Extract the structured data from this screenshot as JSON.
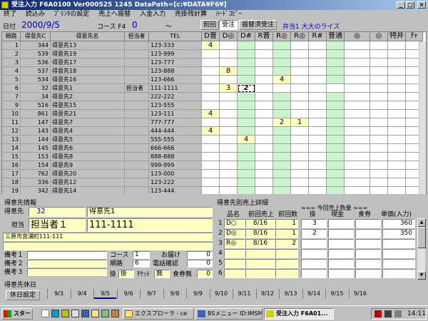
{
  "window": {
    "title": "受注入力 F6A0100 Ver000525 1245  DataPath=[c:¥DATA¥F6¥]"
  },
  "menu": [
    "終了",
    "読込み",
    "ﾌﾟﾘﾝﾀの設定",
    "売上へ振替",
    "入金入力",
    "売掛残計算",
    "ﾊｰﾄﾞｺﾋﾟｰ"
  ],
  "header": {
    "date_label": "日付",
    "date": "2000/9/5",
    "course_label": "コース F4",
    "course": "0",
    "tilde": "～",
    "tabs": [
      "前回",
      "受注",
      "振替済受注"
    ],
    "active_tab": 1,
    "right_info": "弁当1 大大のライス"
  },
  "grid": {
    "columns": [
      "順路",
      "得意先C",
      "得意先名",
      "担当者",
      "TEL",
      "D普",
      "D◎",
      "D#",
      "R普",
      "R◎",
      "R◎",
      "R#",
      "普通",
      "◎",
      "特弁",
      "ﾁｬ"
    ],
    "rows": [
      {
        "no": "1",
        "code": "344",
        "name": "得意先13",
        "tan": "",
        "tel": "123-333",
        "q": [
          [
            "4",
            "yellow"
          ],
          [
            "",
            ""
          ],
          [
            "",
            "green"
          ],
          [
            "",
            ""
          ],
          [
            "",
            "green"
          ],
          [
            "",
            ""
          ],
          [
            "",
            ""
          ],
          [
            "",
            "green"
          ],
          [
            "",
            ""
          ],
          [
            "",
            ""
          ],
          [
            "",
            ""
          ],
          [
            "",
            ""
          ],
          [
            "",
            ""
          ]
        ]
      },
      {
        "no": "2",
        "code": "539",
        "name": "得意先19",
        "tan": "",
        "tel": "123-999",
        "q": [
          [
            "",
            ""
          ],
          [
            "",
            ""
          ],
          [
            "",
            "green"
          ],
          [
            "",
            ""
          ],
          [
            "",
            "green"
          ],
          [
            "",
            ""
          ],
          [
            "",
            ""
          ],
          [
            "",
            "green"
          ],
          [
            "",
            ""
          ],
          [
            "",
            ""
          ],
          [
            "",
            ""
          ],
          [
            "",
            ""
          ],
          [
            "",
            ""
          ]
        ]
      },
      {
        "no": "3",
        "code": "536",
        "name": "得意先17",
        "tan": "",
        "tel": "123-777",
        "q": [
          [
            "",
            ""
          ],
          [
            "",
            ""
          ],
          [
            "",
            "green"
          ],
          [
            "",
            ""
          ],
          [
            "",
            "green"
          ],
          [
            "",
            ""
          ],
          [
            "",
            ""
          ],
          [
            "",
            "green"
          ],
          [
            "",
            ""
          ],
          [
            "",
            ""
          ],
          [
            "",
            ""
          ],
          [
            "",
            ""
          ],
          [
            "",
            ""
          ]
        ]
      },
      {
        "no": "4",
        "code": "537",
        "name": "得意先18",
        "tan": "",
        "tel": "123-888",
        "q": [
          [
            "",
            ""
          ],
          [
            "8",
            "yellow"
          ],
          [
            "",
            "green"
          ],
          [
            "",
            ""
          ],
          [
            "",
            "green"
          ],
          [
            "",
            ""
          ],
          [
            "",
            ""
          ],
          [
            "",
            "green"
          ],
          [
            "",
            ""
          ],
          [
            "",
            ""
          ],
          [
            "",
            ""
          ],
          [
            "",
            ""
          ],
          [
            "",
            ""
          ]
        ]
      },
      {
        "no": "5",
        "code": "534",
        "name": "得意先16",
        "tan": "",
        "tel": "123-666",
        "q": [
          [
            "",
            ""
          ],
          [
            "",
            ""
          ],
          [
            "",
            "green"
          ],
          [
            "",
            ""
          ],
          [
            "4",
            "yellow"
          ],
          [
            "",
            ""
          ],
          [
            "",
            ""
          ],
          [
            "",
            "green"
          ],
          [
            "",
            ""
          ],
          [
            "",
            ""
          ],
          [
            "",
            ""
          ],
          [
            "",
            ""
          ],
          [
            "",
            ""
          ]
        ]
      },
      {
        "no": "6",
        "code": "32",
        "name": "得意先1",
        "tan": "担当者",
        "tel": "111-1111",
        "q": [
          [
            "",
            ""
          ],
          [
            "3",
            "yellow"
          ],
          [
            "2",
            "sel"
          ],
          [
            "",
            ""
          ],
          [
            "",
            ""
          ],
          [
            "",
            ""
          ],
          [
            "",
            ""
          ],
          [
            "",
            ""
          ],
          [
            "",
            ""
          ],
          [
            "",
            ""
          ],
          [
            "",
            ""
          ],
          [
            "",
            ""
          ],
          [
            "",
            ""
          ]
        ]
      },
      {
        "no": "7",
        "code": "34",
        "name": "得意先2",
        "tan": "",
        "tel": "222-222",
        "q": [
          [
            "",
            ""
          ],
          [
            "",
            ""
          ],
          [
            "",
            "green"
          ],
          [
            "",
            ""
          ],
          [
            "",
            "green"
          ],
          [
            "",
            ""
          ],
          [
            "",
            ""
          ],
          [
            "",
            "green"
          ],
          [
            "",
            ""
          ],
          [
            "",
            ""
          ],
          [
            "",
            ""
          ],
          [
            "",
            ""
          ],
          [
            "",
            ""
          ]
        ]
      },
      {
        "no": "9",
        "code": "516",
        "name": "得意先15",
        "tan": "",
        "tel": "123-555",
        "q": [
          [
            "",
            ""
          ],
          [
            "",
            ""
          ],
          [
            "",
            "green"
          ],
          [
            "",
            ""
          ],
          [
            "",
            "green"
          ],
          [
            "",
            ""
          ],
          [
            "",
            ""
          ],
          [
            "",
            "green"
          ],
          [
            "",
            ""
          ],
          [
            "",
            ""
          ],
          [
            "",
            ""
          ],
          [
            "",
            ""
          ],
          [
            "",
            ""
          ]
        ]
      },
      {
        "no": "10",
        "code": "861",
        "name": "得意先21",
        "tan": "",
        "tel": "123-111",
        "q": [
          [
            "4",
            "yellow"
          ],
          [
            "",
            ""
          ],
          [
            "",
            "green"
          ],
          [
            "",
            ""
          ],
          [
            "",
            "green"
          ],
          [
            "",
            ""
          ],
          [
            "",
            ""
          ],
          [
            "",
            "green"
          ],
          [
            "",
            ""
          ],
          [
            "",
            ""
          ],
          [
            "",
            ""
          ],
          [
            "",
            ""
          ],
          [
            "",
            ""
          ]
        ]
      },
      {
        "no": "11",
        "code": "147",
        "name": "得意先7",
        "tan": "",
        "tel": "777-777",
        "q": [
          [
            "",
            ""
          ],
          [
            "",
            ""
          ],
          [
            "",
            "green"
          ],
          [
            "",
            ""
          ],
          [
            "2",
            "yellow"
          ],
          [
            "1",
            "yellow"
          ],
          [
            "",
            ""
          ],
          [
            "",
            "green"
          ],
          [
            "",
            ""
          ],
          [
            "",
            ""
          ],
          [
            "",
            ""
          ],
          [
            "",
            ""
          ],
          [
            "",
            ""
          ]
        ]
      },
      {
        "no": "12",
        "code": "143",
        "name": "得意先4",
        "tan": "",
        "tel": "444-444",
        "q": [
          [
            "4",
            "yellow"
          ],
          [
            "",
            ""
          ],
          [
            "",
            "green"
          ],
          [
            "",
            ""
          ],
          [
            "",
            "green"
          ],
          [
            "",
            ""
          ],
          [
            "",
            ""
          ],
          [
            "",
            "green"
          ],
          [
            "",
            ""
          ],
          [
            "",
            ""
          ],
          [
            "",
            ""
          ],
          [
            "",
            ""
          ],
          [
            "",
            ""
          ]
        ]
      },
      {
        "no": "13",
        "code": "144",
        "name": "得意先5",
        "tan": "",
        "tel": "555-555",
        "q": [
          [
            "",
            ""
          ],
          [
            "",
            ""
          ],
          [
            "4",
            "yellow"
          ],
          [
            "",
            ""
          ],
          [
            "",
            "green"
          ],
          [
            "",
            ""
          ],
          [
            "",
            ""
          ],
          [
            "",
            "green"
          ],
          [
            "",
            ""
          ],
          [
            "",
            ""
          ],
          [
            "",
            ""
          ],
          [
            "",
            ""
          ],
          [
            "",
            ""
          ]
        ]
      },
      {
        "no": "14",
        "code": "145",
        "name": "得意先6",
        "tan": "",
        "tel": "666-666",
        "q": [
          [
            "",
            ""
          ],
          [
            "",
            ""
          ],
          [
            "",
            "green"
          ],
          [
            "",
            ""
          ],
          [
            "",
            "green"
          ],
          [
            "",
            ""
          ],
          [
            "",
            ""
          ],
          [
            "",
            "green"
          ],
          [
            "",
            ""
          ],
          [
            "",
            ""
          ],
          [
            "",
            ""
          ],
          [
            "",
            ""
          ],
          [
            "",
            ""
          ]
        ]
      },
      {
        "no": "15",
        "code": "153",
        "name": "得意先8",
        "tan": "",
        "tel": "888-888",
        "q": [
          [
            "",
            ""
          ],
          [
            "",
            ""
          ],
          [
            "",
            "green"
          ],
          [
            "",
            ""
          ],
          [
            "",
            "green"
          ],
          [
            "",
            ""
          ],
          [
            "",
            ""
          ],
          [
            "",
            "green"
          ],
          [
            "",
            ""
          ],
          [
            "",
            ""
          ],
          [
            "",
            ""
          ],
          [
            "",
            ""
          ],
          [
            "",
            ""
          ]
        ]
      },
      {
        "no": "16",
        "code": "154",
        "name": "得意先9",
        "tan": "",
        "tel": "999-999",
        "q": [
          [
            "",
            ""
          ],
          [
            "",
            ""
          ],
          [
            "",
            "green"
          ],
          [
            "",
            ""
          ],
          [
            "",
            "green"
          ],
          [
            "",
            ""
          ],
          [
            "",
            ""
          ],
          [
            "",
            "green"
          ],
          [
            "",
            ""
          ],
          [
            "",
            ""
          ],
          [
            "",
            ""
          ],
          [
            "",
            ""
          ],
          [
            "",
            ""
          ]
        ]
      },
      {
        "no": "17",
        "code": "762",
        "name": "得意先20",
        "tan": "",
        "tel": "123-000",
        "q": [
          [
            "",
            ""
          ],
          [
            "",
            ""
          ],
          [
            "",
            "green"
          ],
          [
            "",
            ""
          ],
          [
            "",
            "green"
          ],
          [
            "",
            ""
          ],
          [
            "",
            ""
          ],
          [
            "",
            "green"
          ],
          [
            "",
            ""
          ],
          [
            "",
            ""
          ],
          [
            "",
            ""
          ],
          [
            "",
            ""
          ],
          [
            "",
            ""
          ]
        ]
      },
      {
        "no": "18",
        "code": "336",
        "name": "得意先12",
        "tan": "",
        "tel": "123-222",
        "q": [
          [
            "",
            ""
          ],
          [
            "",
            ""
          ],
          [
            "",
            "green"
          ],
          [
            "",
            ""
          ],
          [
            "",
            "green"
          ],
          [
            "",
            ""
          ],
          [
            "",
            ""
          ],
          [
            "",
            "green"
          ],
          [
            "",
            ""
          ],
          [
            "",
            ""
          ],
          [
            "",
            ""
          ],
          [
            "",
            ""
          ],
          [
            "",
            ""
          ]
        ]
      },
      {
        "no": "19",
        "code": "342",
        "name": "得意先14",
        "tan": "",
        "tel": "123-444",
        "q": [
          [
            "",
            ""
          ],
          [
            "",
            ""
          ],
          [
            "",
            "green"
          ],
          [
            "",
            ""
          ],
          [
            "",
            "green"
          ],
          [
            "",
            ""
          ],
          [
            "",
            ""
          ],
          [
            "",
            "green"
          ],
          [
            "",
            ""
          ],
          [
            "",
            ""
          ],
          [
            "",
            ""
          ],
          [
            "",
            ""
          ],
          [
            "",
            ""
          ]
        ]
      }
    ]
  },
  "customer": {
    "section": "得意先情報",
    "code_label": "得意先",
    "code": "32",
    "name": "得意先1",
    "tan_label": "担当",
    "tan": "担当者１",
    "tel": "111-1111",
    "address": "三原市宮浦町111-111",
    "biko_labels": [
      "備考１",
      "備考２",
      "備考３"
    ],
    "course_label": "コース",
    "course": "1",
    "junro_label": "順路",
    "junro": "6",
    "otodoke_label": "お届け",
    "otodoke": "0",
    "denwa_label": "電話確認",
    "denwa": "0",
    "kake_label": "掛",
    "kake": "掛",
    "ticket_label": "ﾁｹｯﾄ",
    "ticket": "無",
    "shokken_label": "食券無",
    "shokken": "0"
  },
  "detail": {
    "section": "得意先別売上詳細",
    "qty_title": "=== 今回売上数量 ===",
    "cols": [
      "品名",
      "前回売上",
      "前回数",
      "掛",
      "現金",
      "食券",
      "単価(入力)"
    ],
    "rows": [
      {
        "n": "1",
        "name": "D○",
        "date": "8/16",
        "qty": "1",
        "kake": "3",
        "price": "360"
      },
      {
        "n": "2",
        "name": "D◎",
        "date": "8/16",
        "qty": "1",
        "kake": "2",
        "price": "350"
      },
      {
        "n": "3",
        "name": "R◎",
        "date": "8/16",
        "qty": "2",
        "kake": "",
        "price": ""
      },
      {
        "n": "4",
        "name": "",
        "date": "",
        "qty": "",
        "kake": "",
        "price": ""
      },
      {
        "n": "5",
        "name": "",
        "date": "",
        "qty": "",
        "kake": "",
        "price": ""
      },
      {
        "n": "6",
        "name": "",
        "date": "",
        "qty": "",
        "kake": "",
        "price": ""
      }
    ]
  },
  "holidays": {
    "label": "得意先休日",
    "button": "休日設定",
    "days": [
      "9/3",
      "9/4",
      "9/5",
      "9/6",
      "9/7",
      "9/8",
      "9/9",
      "9/10",
      "9/11",
      "9/12",
      "9/13",
      "9/14",
      "9/15",
      "9/16"
    ]
  },
  "taskbar": {
    "start": "スタート",
    "tasks": [
      "エクスプローラ - ce",
      "BSメニュー ID:IMSME...",
      "受注入力 F6A01..."
    ],
    "clock": "14:11"
  }
}
